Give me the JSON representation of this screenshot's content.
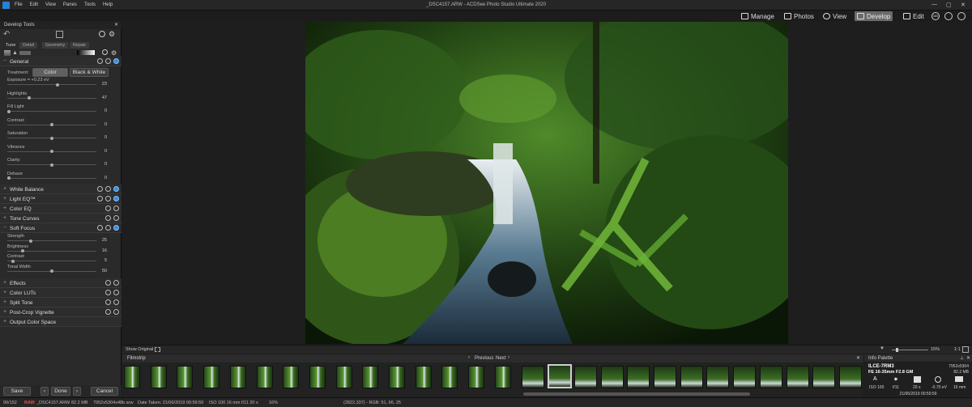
{
  "titlebar": {
    "title": "_DSC4157.ARW - ACDSee Photo Studio Ultimate 2020",
    "menu": [
      "File",
      "Edit",
      "View",
      "Panes",
      "Tools",
      "Help"
    ]
  },
  "modes": [
    "Manage",
    "Photos",
    "View",
    "Develop",
    "Edit"
  ],
  "modes_badge": "365",
  "panel": {
    "title": "Develop Tools",
    "tabs": [
      "Tune",
      "Detail",
      "Geometry",
      "Repair"
    ],
    "sections": {
      "general": "General",
      "white_balance": "White Balance",
      "light_eq": "Light EQ™",
      "color_eq": "Color EQ",
      "tone_curves": "Tone Curves",
      "soft_focus": "Soft Focus",
      "effects": "Effects",
      "color_luts": "Color LUTs",
      "split_tone": "Split Tone",
      "post_crop": "Post-Crop Vignette",
      "output": "Output Color Space"
    },
    "treatment_label": "Treatment:",
    "treatment_options": [
      "Color",
      "Black & White"
    ],
    "general_sliders": [
      {
        "label": "Exposure = +0.23 eV",
        "value": "23",
        "pos": 0.57
      },
      {
        "label": "Highlights",
        "value": "47",
        "pos": 0.24
      },
      {
        "label": "Fill Light",
        "value": "0",
        "pos": 0.0
      },
      {
        "label": "Contrast",
        "value": "0",
        "pos": 0.5
      },
      {
        "label": "Saturation",
        "value": "0",
        "pos": 0.5
      },
      {
        "label": "Vibrance",
        "value": "0",
        "pos": 0.5
      },
      {
        "label": "Clarity",
        "value": "0",
        "pos": 0.5
      },
      {
        "label": "Dehaze",
        "value": "0",
        "pos": 0.0
      }
    ],
    "soft_focus_sliders": [
      {
        "label": "Strength",
        "value": "25",
        "pos": 0.25
      },
      {
        "label": "Brightness",
        "value": "16",
        "pos": 0.16
      },
      {
        "label": "Contrast",
        "value": "5",
        "pos": 0.05
      },
      {
        "label": "Tonal Width",
        "value": "50",
        "pos": 0.5
      }
    ],
    "buttons": {
      "save": "Save",
      "done": "Done",
      "cancel": "Cancel"
    }
  },
  "viewer": {
    "show_original": "Show Original",
    "zoom": "15%",
    "ratio": "1:1"
  },
  "filmstrip": {
    "title": "Filmstrip",
    "previous": "Previous",
    "next": "Next"
  },
  "info": {
    "title": "Info Palette",
    "camera": "ILCE-7RM3",
    "lens": "FE 16-35mm F2.8 GM",
    "dims": "7952x5304",
    "size": "82.2 MB",
    "iso": "ISO 100",
    "aperture": "f/11",
    "shutter": "20 s",
    "ev": "-0.70 eV",
    "focal": "16 mm",
    "date": "21/06/2019 00:59:59"
  },
  "status": {
    "count": "99/152",
    "raw": "RAW",
    "file": "_DSC4157.ARW",
    "size": "82.2 MB",
    "dims": "7952x5304x48b arw",
    "date": "Date Taken: 21/06/2019 00:59:59",
    "exif": "ISO 100    16 mm    f/11    20 s",
    "zoom": "16%",
    "coords": "(2822,337) - RGB: 51, 66, 25"
  },
  "colors": {
    "accent": "#3a8fd8",
    "panel": "#2a2a2a",
    "background": "#1c1c1c"
  }
}
